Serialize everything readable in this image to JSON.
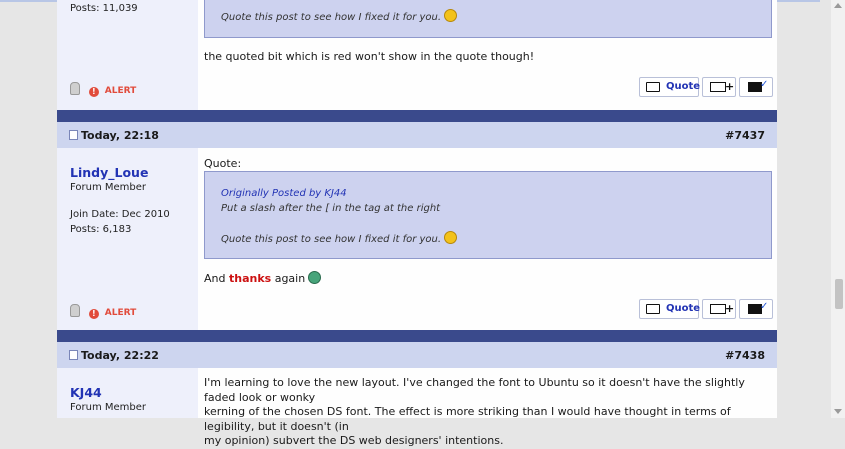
{
  "post_prev": {
    "posts_count": "Posts: 11,039",
    "quote_line": "Quote this post to see how I fixed it for you.",
    "message": "the quoted bit which is red won't show in the quote though!",
    "alert_label": "ALERT",
    "quote_btn": "Quote"
  },
  "post_7437": {
    "date": "Today, 22:18",
    "number": "#7437",
    "username": "Lindy_Loue",
    "rank": "Forum Member",
    "join_date": "Join Date: Dec 2010",
    "posts_count": "Posts: 6,183",
    "quote_label": "Quote:",
    "quote_author": "Originally Posted by KJ44",
    "quote_line1": "Put a slash after the [ in the tag at the right",
    "quote_line2": "Quote this post to see how I fixed it for you.",
    "msg_before": "And ",
    "msg_red": "thanks",
    "msg_after": " again",
    "alert_label": "ALERT",
    "quote_btn": "Quote"
  },
  "post_7438": {
    "date": "Today, 22:22",
    "number": "#7438",
    "username": "KJ44",
    "rank": "Forum Member",
    "message_lines": [
      "I'm learning to love the new layout. I've changed the font to Ubuntu so it doesn't have the slightly faded look or wonky",
      "kerning of the chosen DS font. The effect is more striking than I would have thought in terms of legibility, but it doesn't (in",
      "my opinion) subvert the DS web designers' intentions."
    ]
  },
  "icons": {
    "post_icon": "document-icon",
    "quote": "speech-bubble-icon",
    "multiquote": "multiquote-plus-icon",
    "reply": "quick-reply-icon",
    "offline": "offline-bulb-icon",
    "alert": "alert-icon",
    "smiley": "smiley-icon",
    "grin": "grin-icon"
  },
  "colors": {
    "accent_link": "#2233b4",
    "header_band": "#cdd5ef",
    "separator": "#3a4a8c",
    "alert": "#e14b3b",
    "quote_box": "#cdd2ef"
  }
}
